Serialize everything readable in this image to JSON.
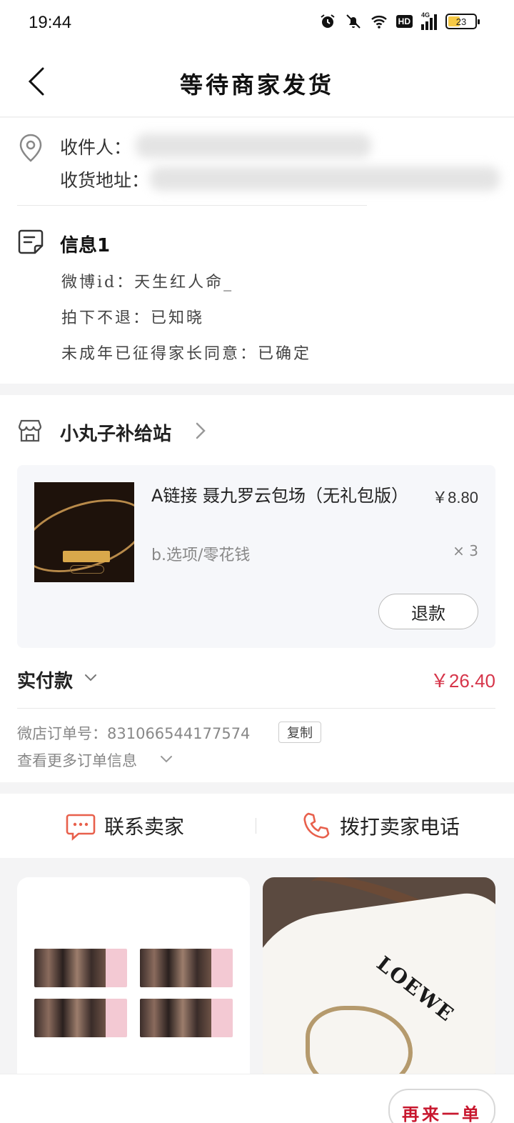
{
  "status_bar": {
    "time": "19:44",
    "network_label": "HD",
    "signal_label": "4G",
    "battery_level": "23"
  },
  "header": {
    "title": "等待商家发货"
  },
  "address": {
    "recipient_label": "收件人：",
    "address_label": "收货地址："
  },
  "info": {
    "title": "信息1",
    "lines": [
      "微博id：天生红人命_",
      "拍下不退：已知晓",
      "未成年已征得家长同意：已确定"
    ]
  },
  "shop": {
    "name": "小丸子补给站"
  },
  "product": {
    "name": "A链接 聂九罗云包场（无礼包版）",
    "price": "￥8.80",
    "spec": "b.选项/零花钱",
    "quantity": "× 3",
    "refund_label": "退款"
  },
  "payment": {
    "label": "实付款",
    "amount": "￥26.40"
  },
  "order_info": {
    "order_number": "微店订单号：831066544177574",
    "copy_label": "复制",
    "more_label": "查看更多订单信息"
  },
  "contact": {
    "message_label": "联系卖家",
    "call_label": "拨打卖家电话"
  },
  "recommendations": {
    "item2_logo": "LOEWE"
  },
  "bottom": {
    "reorder_label": "再来一单"
  },
  "colors": {
    "accent_price": "#d6354a",
    "contact_icon": "#e8604c",
    "reorder_text": "#c8172e"
  },
  "icons": {
    "back": "chevron-left-icon",
    "location": "location-pin-icon",
    "message": "message-note-icon",
    "shop": "store-icon",
    "chat": "chat-bubble-icon",
    "phone": "phone-icon"
  }
}
